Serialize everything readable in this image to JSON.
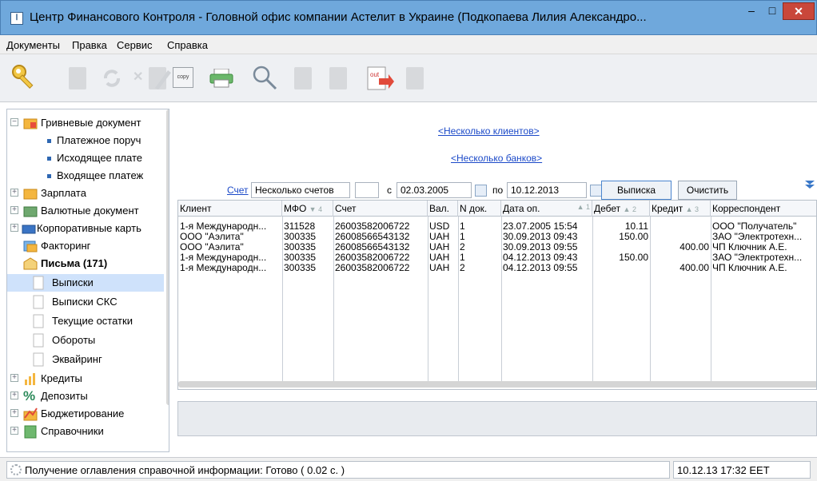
{
  "window": {
    "title": "Центр Финансового Контроля - Головной офис компании Астелит в Украине (Подкопаева Лилия Александро...",
    "min_label": "–",
    "max_label": "□",
    "close_label": "✕"
  },
  "menu": {
    "items": [
      "Документы",
      "Правка",
      "Сервис",
      "Справка"
    ]
  },
  "toolbar": {
    "copy_label": "copy",
    "out_label": "out"
  },
  "tree": {
    "items": [
      {
        "label": "Гривневые документ",
        "icon": "folder-uah-icon"
      },
      {
        "label": "Платежное поруч"
      },
      {
        "label": "Исходящее плате"
      },
      {
        "label": "Входящее платеж"
      },
      {
        "label": "Зарплата",
        "icon": "folder-salary-icon"
      },
      {
        "label": "Валютные документ",
        "icon": "folder-currency-icon"
      },
      {
        "label": "Корпоративные карть",
        "icon": "cards-icon"
      },
      {
        "label": "Факторинг",
        "icon": "factoring-icon"
      },
      {
        "label": "Письма (171)",
        "icon": "envelope-icon"
      },
      {
        "label": "Выписки",
        "icon": "document-icon"
      },
      {
        "label": "Выписки СКС",
        "icon": "document-icon"
      },
      {
        "label": "Текущие остатки",
        "icon": "document-icon"
      },
      {
        "label": "Обороты",
        "icon": "document-icon"
      },
      {
        "label": "Эквайринг",
        "icon": "document-icon"
      },
      {
        "label": "Кредиты",
        "icon": "credits-icon"
      },
      {
        "label": "Депозиты",
        "icon": "percent-icon"
      },
      {
        "label": "Бюджетирование",
        "icon": "budget-icon"
      },
      {
        "label": "Справочники",
        "icon": "directory-icon"
      }
    ]
  },
  "filters": {
    "clients_link": "<Несколько клиентов>",
    "banks_link": "<Несколько банков>",
    "account_link": "Счет",
    "account_value": "Несколько счетов",
    "from_label": "с",
    "from_date": "02.03.2005",
    "to_label": "по",
    "to_date": "10.12.2013",
    "statement_button": "Выписка",
    "clear_button": "Очистить"
  },
  "grid": {
    "columns": [
      {
        "label": "Клиент",
        "sort": ""
      },
      {
        "label": "МФО",
        "sort": "▼ 4"
      },
      {
        "label": "Счет",
        "sort": ""
      },
      {
        "label": "Вал.",
        "sort": ""
      },
      {
        "label": "N док.",
        "sort": ""
      },
      {
        "label": "Дата оп.",
        "sort": "▲ 1"
      },
      {
        "label": "Дебет",
        "sort": "▲ 2"
      },
      {
        "label": "Кредит",
        "sort": "▲ 3"
      },
      {
        "label": "Корреспондент",
        "sort": ""
      }
    ],
    "rows": [
      [
        "1-я Международн...",
        "311528",
        "26003582006722",
        "USD",
        "1",
        "23.07.2005 15:54",
        "10.11",
        "",
        "ООО \"Получатель\""
      ],
      [
        "ООО \"Аэлита\"",
        "300335",
        "26008566543132",
        "UAH",
        "1",
        "30.09.2013 09:43",
        "150.00",
        "",
        "ЗАО \"Электротехн..."
      ],
      [
        "ООО \"Аэлита\"",
        "300335",
        "26008566543132",
        "UAH",
        "2",
        "30.09.2013 09:55",
        "",
        "400.00",
        "ЧП Ключник А.Е."
      ],
      [
        "1-я Международн...",
        "300335",
        "26003582006722",
        "UAH",
        "1",
        "04.12.2013 09:43",
        "150.00",
        "",
        "ЗАО \"Электротехн..."
      ],
      [
        "1-я Международн...",
        "300335",
        "26003582006722",
        "UAH",
        "2",
        "04.12.2013 09:55",
        "",
        "400.00",
        "ЧП Ключник А.Е."
      ]
    ]
  },
  "status": {
    "message": "Получение оглавления справочной информации: Готово ( 0.02 с. )",
    "datetime": "10.12.13 17:32 EET"
  }
}
